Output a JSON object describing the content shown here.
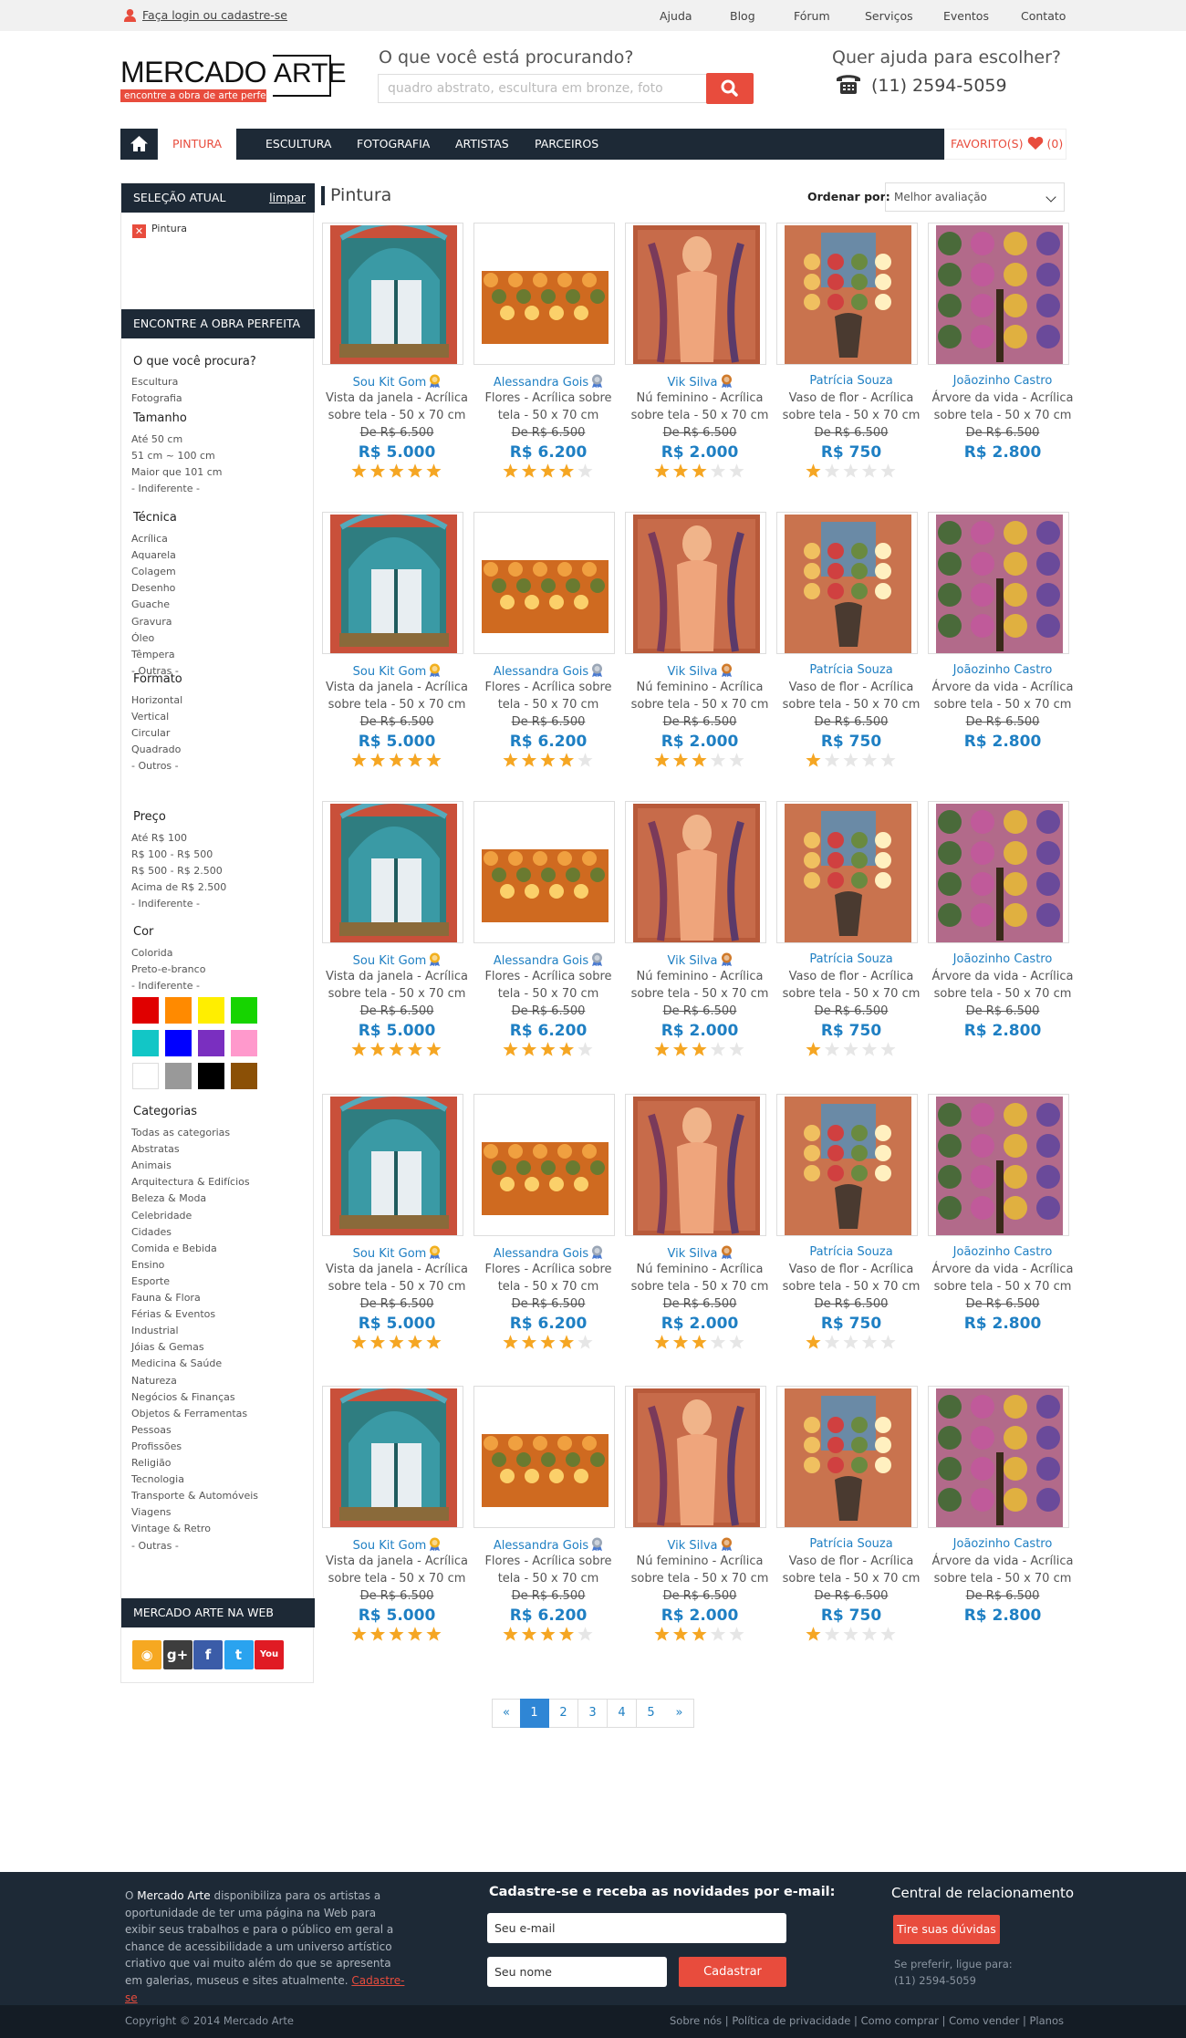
{
  "topbar": {
    "login": "Faça login ou cadastre-se",
    "links": [
      "Ajuda",
      "Blog",
      "Fórum",
      "Serviços",
      "Eventos",
      "Contato"
    ]
  },
  "logo": {
    "word1": "MERCADO",
    "word2": "ARTE",
    "tagline": "encontre a obra de arte perfeita!"
  },
  "search": {
    "heading": "O que você está procurando?",
    "placeholder": "quadro abstrato, escultura em bronze, foto",
    "button_icon": "search-icon"
  },
  "help": {
    "heading": "Quer ajuda para escolher?",
    "phone": "(11) 2594-5059",
    "phone_icon": "telephone-icon"
  },
  "nav": {
    "home_icon": "home-icon",
    "items": [
      "PINTURA",
      "ESCULTURA",
      "FOTOGRAFIA",
      "ARTISTAS",
      "PARCEIROS"
    ],
    "active": "PINTURA",
    "favorites": "FAVORITO(S)",
    "favorites_count": "(0)"
  },
  "sidebar": {
    "selection_title": "SELEÇÃO ATUAL",
    "clear": "limpar",
    "selected": "Pintura",
    "finder_title": "ENCONTRE A OBRA PERFEITA",
    "groups": [
      {
        "title": "O que você procura?",
        "items": [
          "Escultura",
          "Fotografia"
        ]
      },
      {
        "title": "Tamanho",
        "items": [
          "Até 50 cm",
          "51 cm ~ 100 cm",
          "Maior que 101 cm",
          "- Indiferente -"
        ]
      },
      {
        "title": "Técnica",
        "items": [
          "Acrílica",
          "Aquarela",
          "Colagem",
          "Desenho",
          "Guache",
          "Gravura",
          "Óleo",
          "Têmpera",
          "- Outras -"
        ]
      },
      {
        "title": "Formato",
        "items": [
          "Horizontal",
          "Vertical",
          "Circular",
          "Quadrado",
          "- Outros -"
        ]
      },
      {
        "title": "Preço",
        "items": [
          "Até R$ 100",
          "R$ 100 - R$ 500",
          "R$ 500 - R$ 2.500",
          "Acima de R$ 2.500",
          "- Indiferente -"
        ]
      },
      {
        "title": "Cor",
        "items": [
          "Colorida",
          "Preto-e-branco",
          "- Indiferente -"
        ]
      },
      {
        "title": "Categorias",
        "items": [
          "Todas as categorias",
          "Abstratas",
          "Animais",
          "Arquitectura & Edifícios",
          "Beleza & Moda",
          "Celebridade",
          "Cidades",
          "Comida e Bebida",
          "Ensino",
          "Esporte",
          "Fauna & Flora",
          "Férias & Eventos",
          "Industrial",
          "Jóias & Gemas",
          "Medicina & Saúde",
          "Natureza",
          "Negócios & Finanças",
          "Objetos & Ferramentas",
          "Pessoas",
          "Profissões",
          "Religião",
          "Tecnologia",
          "Transporte & Automóveis",
          "Viagens",
          "Vintage & Retro",
          "- Outras -"
        ]
      }
    ],
    "colors": [
      "#e00000",
      "#ff8a00",
      "#ffee00",
      "#16d400",
      "#12c6c6",
      "#0000ff",
      "#7a2fc0",
      "#ff99cc",
      "#ffffff",
      "#999999",
      "#000000",
      "#8b5006"
    ],
    "social_title": "MERCADO ARTE NA WEB",
    "social": [
      {
        "icon": "rss-icon",
        "color": "#f6a821",
        "glyph": "◉"
      },
      {
        "icon": "google-plus-icon",
        "color": "#3d3d3d",
        "glyph": "g+"
      },
      {
        "icon": "facebook-icon",
        "color": "#3b5ca8",
        "glyph": "f"
      },
      {
        "icon": "twitter-icon",
        "color": "#2aa3ef",
        "glyph": "t"
      },
      {
        "icon": "youtube-icon",
        "color": "#e01b24",
        "glyph": "You"
      }
    ]
  },
  "main": {
    "title": "Pintura",
    "sort_label": "Ordenar por:",
    "sort_value": "Melhor avaliação"
  },
  "products": [
    {
      "artist": "Sou Kit Gom",
      "badge": "gold",
      "title1": "Vista da janela - Acrílica",
      "title2": "sobre tela - 50 x 70 cm",
      "old_price": "De R$ 6.500",
      "price": "R$ 5.000",
      "rating": 5,
      "art": "window"
    },
    {
      "artist": "Alessandra Gois",
      "badge": "silver",
      "title1": "Flores - Acrílica sobre",
      "title2": "tela - 50 x 70 cm",
      "old_price": "De R$ 6.500",
      "price": "R$ 6.200",
      "rating": 4,
      "art": "flowers"
    },
    {
      "artist": "Vik Silva",
      "badge": "bronze",
      "title1": "Nú feminino - Acrílica",
      "title2": "sobre tela - 50 x 70 cm",
      "old_price": "De R$ 6.500",
      "price": "R$ 2.000",
      "rating": 3,
      "art": "nude"
    },
    {
      "artist": "Patrícia Souza",
      "badge": "",
      "title1": "Vaso de flor - Acrílica",
      "title2": "sobre tela - 50 x 70 cm",
      "old_price": "De R$ 6.500",
      "price": "R$ 750",
      "rating": 1,
      "art": "vase"
    },
    {
      "artist": "Joãozinho Castro",
      "badge": "",
      "title1": "Árvore da vida - Acrílica",
      "title2": "sobre tela - 50 x 70 cm",
      "old_price": "De R$ 6.500",
      "price": "R$ 2.800",
      "rating": 0,
      "art": "tree"
    }
  ],
  "pagination": [
    "«",
    "1",
    "2",
    "3",
    "4",
    "5",
    "»"
  ],
  "pagination_active": "1",
  "footer": {
    "about_pre": "O ",
    "about_brand": "Mercado Arte",
    "about_text": " disponibiliza para os artistas a oportunidade de ter uma página na Web para exibir seus trabalhos e para o público em geral a chance de acessibilidade a um universo artístico criativo que vai muito além do que se apresenta em galerias, museus e sites atualmente. ",
    "about_link": "Cadastre-se",
    "newsletter_title": "Cadastre-se e receba as novidades por e-mail:",
    "email_placeholder": "Seu e-mail",
    "name_placeholder": "Seu nome",
    "submit": "Cadastrar",
    "central_title": "Central de relacionamento",
    "doubts_button": "Tire suas dúvidas",
    "call_text": "Se preferir, ligue para:",
    "call_phone": "(11) 2594-5059",
    "copyright": "Copyright © 2014 Mercado Arte",
    "links": [
      "Sobre nós",
      "Política de privacidade",
      "Como comprar",
      "Como vender",
      "Planos"
    ]
  }
}
